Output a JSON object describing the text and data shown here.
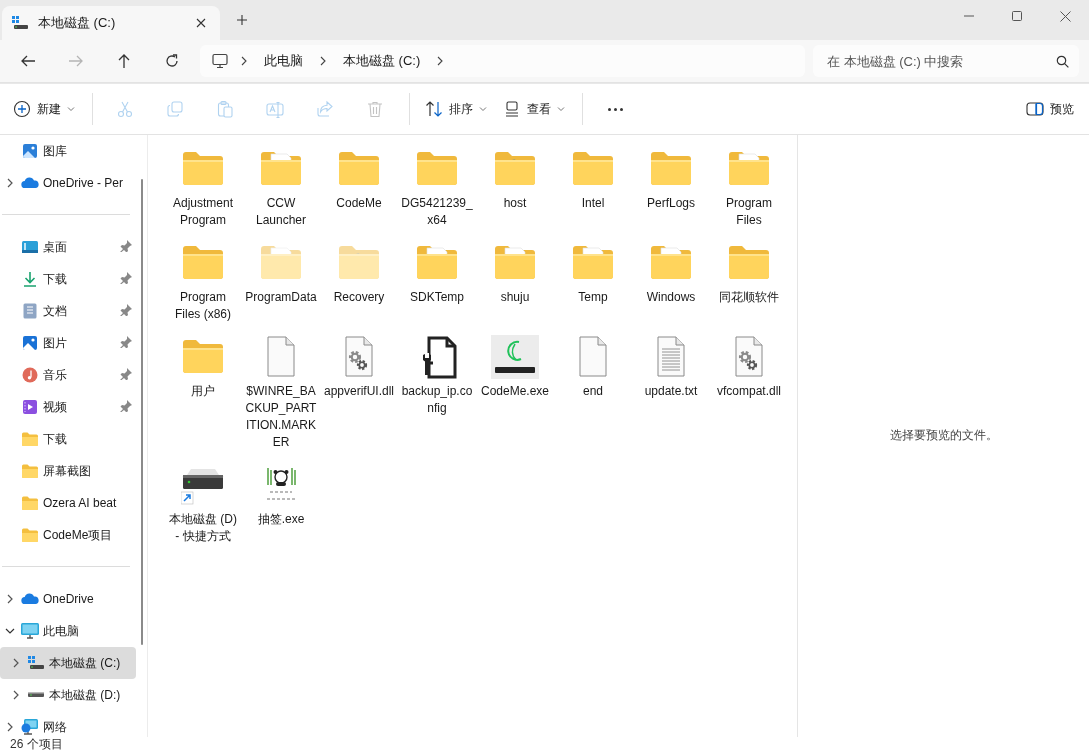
{
  "tabs": [
    {
      "title": "本地磁盘 (C:)",
      "selected": true
    }
  ],
  "nav_buttons": [
    {
      "kind": "back",
      "disabled": false
    },
    {
      "kind": "forward",
      "disabled": true
    },
    {
      "kind": "up",
      "disabled": false
    },
    {
      "kind": "refresh",
      "disabled": false
    }
  ],
  "address": {
    "crumbs": [
      "此电脑",
      "本地磁盘 (C:)"
    ]
  },
  "search": {
    "placeholder": "在 本地磁盘 (C:) 中搜索"
  },
  "toolbar": {
    "items": [
      {
        "kind": "new",
        "label": "新建",
        "disabled": false
      },
      {
        "kind": "cut",
        "disabled": true
      },
      {
        "kind": "copy",
        "disabled": true
      },
      {
        "kind": "paste",
        "disabled": true
      },
      {
        "kind": "rename",
        "disabled": true
      },
      {
        "kind": "share",
        "disabled": true
      },
      {
        "kind": "delete",
        "disabled": true
      },
      {
        "kind": "sort",
        "label": "排序",
        "disabled": false
      },
      {
        "kind": "view",
        "label": "查看",
        "disabled": false
      },
      {
        "kind": "more",
        "disabled": false
      }
    ],
    "preview_button": {
      "label": "预览"
    }
  },
  "sidebar": {
    "sections": [
      {
        "items": [
          {
            "kind": "gallery",
            "label": "图库",
            "selected": false
          },
          {
            "kind": "onedrive",
            "label": "OneDrive - Per",
            "expanded": false,
            "selected": false
          }
        ]
      },
      {
        "items": [
          {
            "kind": "desktop",
            "label": "桌面",
            "pinned": true,
            "selected": false
          },
          {
            "kind": "download",
            "label": "下载",
            "pinned": true,
            "selected": false
          },
          {
            "kind": "documents",
            "label": "文档",
            "pinned": true,
            "selected": false
          },
          {
            "kind": "pictures",
            "label": "图片",
            "pinned": true,
            "selected": false
          },
          {
            "kind": "music",
            "label": "音乐",
            "pinned": true,
            "selected": false
          },
          {
            "kind": "videos",
            "label": "视频",
            "pinned": true,
            "selected": false
          },
          {
            "kind": "folder",
            "label": "下载",
            "pinned": false,
            "selected": false
          },
          {
            "kind": "folder",
            "label": "屏幕截图",
            "pinned": false,
            "selected": false
          },
          {
            "kind": "folder",
            "label": "Ozera AI beat",
            "pinned": false,
            "selected": false
          },
          {
            "kind": "folder",
            "label": "CodeMe项目",
            "pinned": false,
            "selected": false
          }
        ]
      },
      {
        "items": [
          {
            "kind": "onedrive",
            "label": "OneDrive",
            "expanded": false,
            "selected": false
          },
          {
            "kind": "pc",
            "label": "此电脑",
            "expanded": true,
            "selected": false,
            "children": [
              {
                "kind": "drive-c",
                "label": "本地磁盘 (C:)",
                "expanded": false,
                "selected": true
              },
              {
                "kind": "drive-d",
                "label": "本地磁盘 (D:)",
                "expanded": false,
                "selected": false
              }
            ]
          },
          {
            "kind": "network",
            "label": "网络",
            "expanded": false,
            "selected": false
          }
        ]
      }
    ]
  },
  "files": [
    {
      "name": "Adjustment Program",
      "kind": "folder",
      "hidden": false
    },
    {
      "name": "CCW Launcher",
      "kind": "folder-files",
      "hidden": false
    },
    {
      "name": "CodeMe",
      "kind": "folder",
      "hidden": false
    },
    {
      "name": "DG5421239_x64",
      "kind": "folder",
      "hidden": false
    },
    {
      "name": "host",
      "kind": "folder-edge",
      "hidden": false
    },
    {
      "name": "Intel",
      "kind": "folder",
      "hidden": false
    },
    {
      "name": "PerfLogs",
      "kind": "folder",
      "hidden": false
    },
    {
      "name": "Program Files",
      "kind": "folder-files",
      "hidden": false
    },
    {
      "name": "Program Files (x86)",
      "kind": "folder",
      "hidden": false
    },
    {
      "name": "ProgramData",
      "kind": "folder-files",
      "hidden": true
    },
    {
      "name": "Recovery",
      "kind": "folder-edge",
      "hidden": true
    },
    {
      "name": "SDKTemp",
      "kind": "folder-files",
      "hidden": false
    },
    {
      "name": "shuju",
      "kind": "folder-files",
      "hidden": false
    },
    {
      "name": "Temp",
      "kind": "folder-files",
      "hidden": false
    },
    {
      "name": "Windows",
      "kind": "folder-files",
      "hidden": false
    },
    {
      "name": "同花顺软件",
      "kind": "folder",
      "hidden": false
    },
    {
      "name": "用户",
      "kind": "folder",
      "hidden": false
    },
    {
      "name": "$WINRE_BACKUP_PARTITION.MARKER",
      "kind": "file-blank",
      "hidden": false
    },
    {
      "name": "appverifUI.dll",
      "kind": "file-gear",
      "hidden": false
    },
    {
      "name": "backup_ip.config",
      "kind": "file-config",
      "hidden": false
    },
    {
      "name": "CodeMe.exe",
      "kind": "app-codeme",
      "hidden": false
    },
    {
      "name": "end",
      "kind": "file-blank",
      "hidden": false
    },
    {
      "name": "update.txt",
      "kind": "file-text",
      "hidden": false
    },
    {
      "name": "vfcompat.dll",
      "kind": "file-gear",
      "hidden": false
    },
    {
      "name": "本地磁盘 (D) - 快捷方式",
      "kind": "drive-shortcut",
      "hidden": false
    },
    {
      "name": "抽签.exe",
      "kind": "app-lottery",
      "hidden": false
    }
  ],
  "preview": {
    "message": "选择要预览的文件。"
  },
  "status_bar": {
    "count": "26 个项目"
  }
}
